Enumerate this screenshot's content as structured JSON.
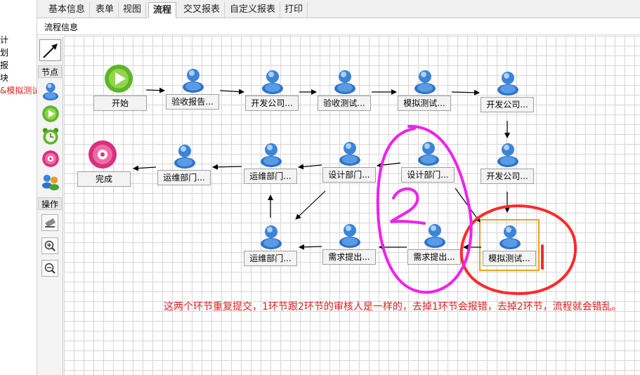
{
  "tabs": [
    "基本信息",
    "表单",
    "视图",
    "流程",
    "交叉报表",
    "自定义报表",
    "打印"
  ],
  "active_tab": "流程",
  "subheader": "流程信息",
  "left_tree": [
    "计",
    "划",
    "报",
    "块",
    "&模拟测试"
  ],
  "palette": {
    "section_nodes": "节点",
    "section_ops": "操作",
    "node_tools": [
      "user-node-icon",
      "start-node-icon",
      "timer-node-icon",
      "end-node-icon",
      "group-node-icon"
    ],
    "op_tools": [
      "eraser-icon",
      "zoom-in-icon",
      "zoom-out-icon"
    ]
  },
  "nodes": {
    "start": "开始",
    "n1": "验收报告...",
    "n2": "开发公司...",
    "n3": "验收测试...",
    "n4": "模拟测试...",
    "n5": "开发公司...",
    "n6": "开发公司...",
    "n7": "设计部门...",
    "n8": "设计部门...",
    "n9": "运维部门...",
    "n10": "运维部门...",
    "end": "完成",
    "n11": "模拟测试...",
    "n12": "需求提出...",
    "n13": "需求提出...",
    "n14": "运维部门..."
  },
  "annotation": "这两个环节重复提交，1环节跟2环节的审核人是一样的，去掉1环节会报错，去掉2环节，流程就会错乱。",
  "colors": {
    "annotation": "#e02020",
    "circle1": "#ff2a2a",
    "circle2": "#ee22ee",
    "selection": "#f0a020"
  }
}
